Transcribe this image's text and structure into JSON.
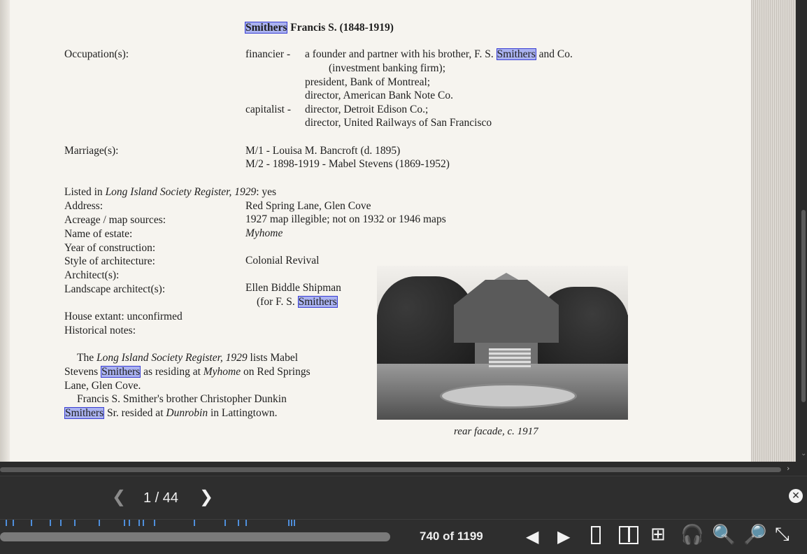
{
  "document": {
    "heading_highlight": "Smithers",
    "heading_rest": "Francis S. (1848-1919)",
    "occupation_label": "Occupation(s):",
    "occ1_role": "financier -",
    "occ1_line1_a": "a founder and partner with his brother, F. S.",
    "occ1_line1_hl": "Smithers",
    "occ1_line1_b": "and Co.",
    "occ1_line2": "(investment banking firm);",
    "occ1_line3": "president, Bank of Montreal;",
    "occ1_line4": "director, American Bank Note Co.",
    "occ2_role": "capitalist -",
    "occ2_line1": "director, Detroit Edison Co.;",
    "occ2_line2": "director, United Railways of San Francisco",
    "marriage_label": "Marriage(s):",
    "marriage1": "M/1 - Louisa M. Bancroft (d. 1895)",
    "marriage2": "M/2 - 1898-1919 - Mabel Stevens (1869-1952)",
    "listed_prefix": "Listed in ",
    "listed_italic": "Long Island Society Register, 1929",
    "listed_suffix": ":  yes",
    "address_label": "Address:",
    "address_value": "Red Spring Lane, Glen Cove",
    "acreage_label": "Acreage / map sources:",
    "acreage_value": "1927 map illegible;  not on 1932 or 1946 maps",
    "estate_label": "Name of estate:",
    "estate_value": "Myhome",
    "year_label": "Year of construction:",
    "style_label": "Style of architecture:",
    "style_value": "Colonial Revival",
    "architect_label": "Architect(s):",
    "landscape_label": "Landscape architect(s):",
    "landscape_value": "Ellen Biddle Shipman",
    "landscape_for": "(for F. S.",
    "landscape_hl": "Smithers",
    "house_extant": "House extant:  unconfirmed",
    "historical_label": "Historical notes:",
    "note1_a": "The ",
    "note1_i": "Long Island Society Register, 1929",
    "note1_b": " lists Mabel",
    "note2_a": "Stevens",
    "note2_hl": "Smithers",
    "note2_b": " as residing at ",
    "note2_i": "Myhome",
    "note2_c": " on Red Springs",
    "note3": "Lane, Glen Cove.",
    "note4": "Francis S. Smither's brother Christopher Dunkin",
    "note5_hl": "Smithers",
    "note5_a": " Sr. resided at ",
    "note5_i": "Dunrobin",
    "note5_b": " in Lattingtown.",
    "caption": "rear facade, c. 1917"
  },
  "navigation": {
    "result_counter": "1 / 44",
    "page_counter": "740 of 1199"
  },
  "icons": {
    "prev_result": "chevron-left-icon",
    "next_result": "chevron-right-icon",
    "close": "close-circle-icon",
    "prev_page": "triangle-left-icon",
    "next_page": "triangle-right-icon",
    "single_page": "single-page-icon",
    "two_page": "two-page-icon",
    "thumbnails": "grid-icon",
    "read_aloud": "headphones-icon",
    "zoom_out": "zoom-out-icon",
    "zoom_in": "zoom-in-icon",
    "exit_fullscreen": "exit-fullscreen-icon"
  },
  "colors": {
    "highlight_fill": "#aab2f0",
    "highlight_border": "#3a3fd4",
    "tick_marks": "#4f8fdc"
  }
}
